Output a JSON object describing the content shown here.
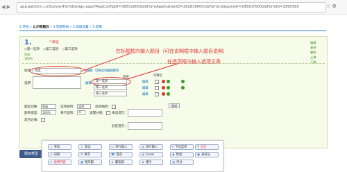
{
  "browser": {
    "url": "app.askform.cn/Survey/FormDesign.aspx?AppConfigID=3955200002&FormApplicationID=2826390001&FormCategoryID=2855070001&FormID=2995580"
  },
  "steps": {
    "s1": "1.开始",
    "s2": "2.问卷题目",
    "s3": "3.页面布局",
    "s4": "4.高级设置",
    "s5": "5.结束",
    "arrow": "»"
  },
  "question": {
    "number": "1.",
    "type_label": "* 单选",
    "options": [
      "○第一选项",
      "○第二选项",
      "○第三选项"
    ],
    "meta1": "完成",
    "meta2": "100%",
    "side_buttons": [
      "编辑",
      "复制",
      "删除",
      "上移",
      "下移"
    ]
  },
  "annotations": {
    "title_note": "在标题框内输入题目（可在说明框中输入题目说明）",
    "option_note": "在选项框内输入选项文章"
  },
  "editor": {
    "title_label": "标题",
    "title_value": "单选",
    "edit_link": "编辑",
    "hide_link": "切换选项编辑模式",
    "desc_label": "说明",
    "desc_edit": "编辑",
    "col_options": "选项",
    "col_fill": "可填空",
    "options": [
      "第一选项",
      "第二选项",
      "第三选项"
    ],
    "opt_edit": "编辑"
  },
  "settings": {
    "type_label": "题型切换：",
    "type_value": "单选",
    "order_label": "选项排列：",
    "order_value": "竖排",
    "random_label": "选项随机：",
    "close_btn": "关闭",
    "width_label": "题目宽度：",
    "width_value": "100%",
    "perrow_label": "每行选项：",
    "perrow_value": "0",
    "score_label": "设置分值：",
    "unselected_label": "未选提示：",
    "required_label": "是否必填：",
    "verify_label": "验证提示："
  },
  "toolbar": {
    "tab": "题目类型",
    "items": [
      {
        "icon": "○",
        "label": "单选",
        "red": false
      },
      {
        "icon": "☐",
        "label": "多选",
        "red": false
      },
      {
        "icon": "▭",
        "label": "单行输入",
        "red": false
      },
      {
        "icon": "▤",
        "label": "多行输入",
        "red": false
      },
      {
        "icon": "▾",
        "label": "下拉菜单",
        "red": false
      },
      {
        "icon": "¶",
        "label": "分页",
        "red": true
      },
      {
        "icon": "◷",
        "label": "日期",
        "red": false
      },
      {
        "icon": "#",
        "label": "数字",
        "red": false
      },
      {
        "icon": "☎",
        "label": "电话",
        "red": false
      },
      {
        "icon": "@",
        "label": "Email",
        "red": false
      },
      {
        "icon": "◉",
        "label": "性别",
        "red": false
      },
      {
        "icon": "▣",
        "label": "身份证",
        "red": false
      },
      {
        "icon": "✎",
        "label": "说明内容",
        "red": true
      },
      {
        "icon": "▦",
        "label": "矩阵题",
        "red": false
      },
      {
        "icon": "★",
        "label": "量表题",
        "red": false
      },
      {
        "icon": "⇅",
        "label": "排序",
        "red": false
      },
      {
        "icon": "▥",
        "label": "评分",
        "red": false
      }
    ]
  }
}
